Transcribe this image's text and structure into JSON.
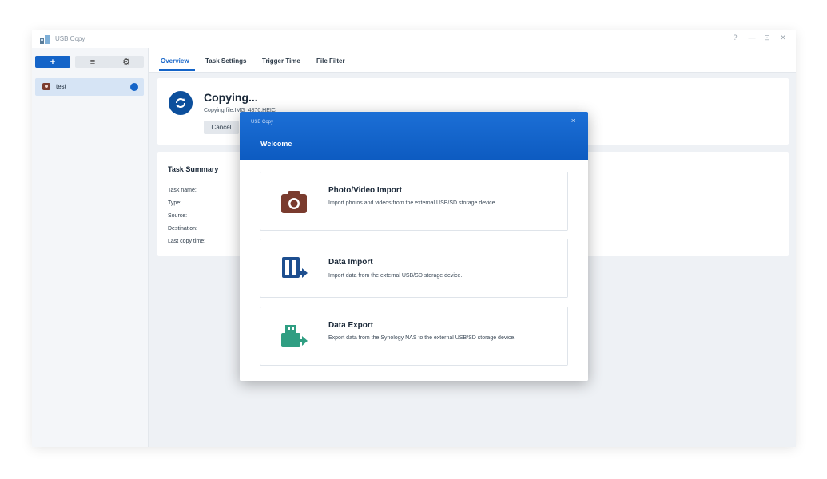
{
  "window": {
    "title": "USB Copy",
    "controls": [
      "?",
      "—",
      "⊡",
      "✕"
    ]
  },
  "sidebar": {
    "add_label": "+",
    "list_label": "≡",
    "settings_label": "⚙",
    "tasks": [
      {
        "label": "test",
        "status_color": "#1464c8"
      }
    ]
  },
  "main": {
    "tabs": [
      {
        "label": "Overview",
        "active": true
      },
      {
        "label": "Task Settings",
        "active": false
      },
      {
        "label": "Trigger Time",
        "active": false
      },
      {
        "label": "File Filter",
        "active": false
      }
    ],
    "status": {
      "icon": "sync-icon",
      "title": "Copying...",
      "detail": "Copying file:IMG_4870.HEIC",
      "cancel_label": "Cancel"
    },
    "summary": {
      "title": "Task Summary",
      "fields": [
        "Task name:",
        "Type:",
        "Source:",
        "Destination:",
        "Last copy time:"
      ]
    }
  },
  "dialog": {
    "small_title": "USB Copy",
    "close_label": "×",
    "title": "Welcome",
    "options": [
      {
        "icon": "camera-icon",
        "title": "Photo/Video Import",
        "description": "Import photos and videos from the external USB/SD storage device."
      },
      {
        "icon": "data-import-icon",
        "title": "Data Import",
        "description": "Import data from the external USB/SD storage device."
      },
      {
        "icon": "data-export-icon",
        "title": "Data Export",
        "description": "Export data from the Synology NAS to the external USB/SD storage device."
      }
    ]
  },
  "colors": {
    "accent": "#1464c8",
    "dialog_header": "#0d5bc1",
    "camera": "#7a3b2e",
    "import": "#1d4e8f",
    "export": "#2f9e82"
  }
}
